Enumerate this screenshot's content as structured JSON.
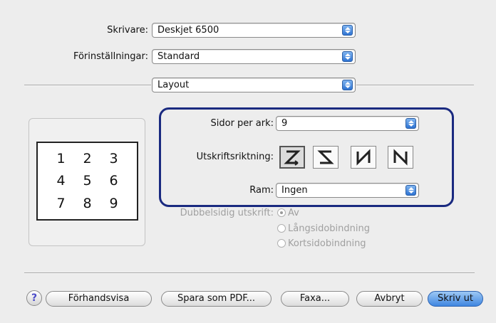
{
  "printer": {
    "label": "Skrivare:",
    "value": "Deskjet 6500"
  },
  "presets": {
    "label": "Förinställningar:",
    "value": "Standard"
  },
  "panel": {
    "value": "Layout"
  },
  "preview": {
    "pages": [
      "1",
      "2",
      "3",
      "4",
      "5",
      "6",
      "7",
      "8",
      "9"
    ]
  },
  "pages_per_sheet": {
    "label": "Sidor per ark:",
    "value": "9"
  },
  "direction": {
    "label": "Utskriftsriktning:",
    "options": [
      "Z",
      "Z-reversed",
      "N-reversed",
      "N"
    ],
    "selected_index": 0
  },
  "border": {
    "label": "Ram:",
    "value": "Ingen"
  },
  "duplex": {
    "label": "Dubbelsidig utskrift:",
    "options": [
      "Av",
      "Långsidobindning",
      "Kortsidobindning"
    ],
    "selected_index": 0
  },
  "buttons": {
    "help": "?",
    "preview": "Förhandsvisa",
    "save_pdf": "Spara som PDF...",
    "fax": "Faxa...",
    "cancel": "Avbryt",
    "print": "Skriv ut"
  }
}
